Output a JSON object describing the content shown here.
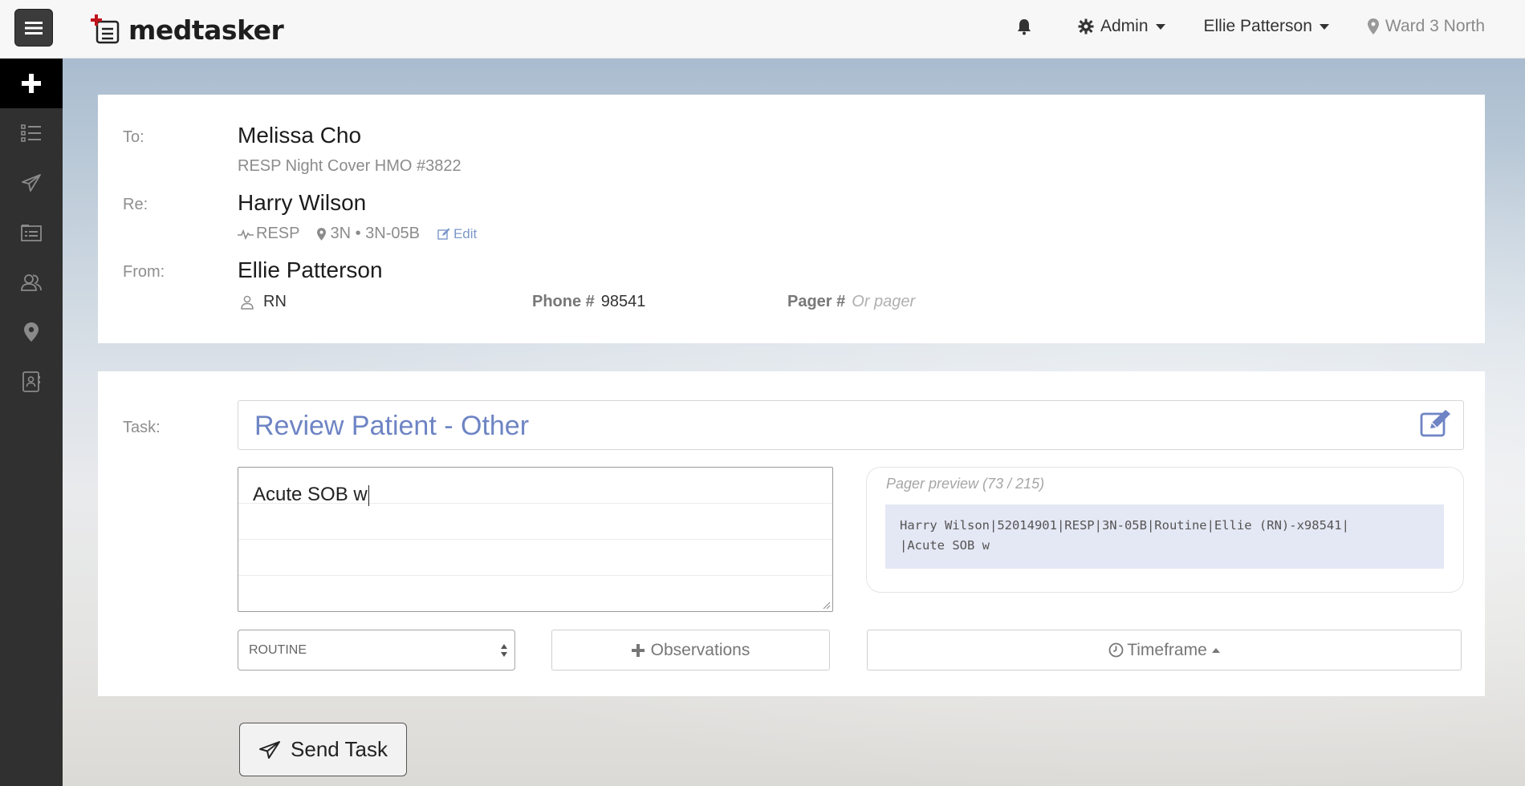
{
  "app": {
    "logo_text": "medtasker",
    "brand_color": "#c0141c"
  },
  "topnav": {
    "admin_label": "Admin",
    "user_label": "Ellie Patterson",
    "ward_label": "Ward 3 North"
  },
  "sidebar": {
    "items": [
      {
        "icon": "plus-icon",
        "active": true
      },
      {
        "icon": "task-list-icon"
      },
      {
        "icon": "send-icon"
      },
      {
        "icon": "patient-list-icon"
      },
      {
        "icon": "people-icon"
      },
      {
        "icon": "location-icon"
      },
      {
        "icon": "contacts-icon"
      }
    ]
  },
  "recipient": {
    "to_label": "To:",
    "to_name": "Melissa Cho",
    "to_role": "RESP Night Cover HMO  #3822",
    "re_label": "Re:",
    "patient_name": "Harry Wilson",
    "patient_unit": "RESP",
    "patient_location": "3N • 3N-05B",
    "edit_label": "Edit",
    "from_label": "From:",
    "from_name": "Ellie Patterson",
    "from_role": "RN",
    "phone_label": "Phone #",
    "phone_value": "98541",
    "pager_label": "Pager #",
    "pager_placeholder": "Or pager"
  },
  "task": {
    "label": "Task:",
    "title": "Review Patient - Other",
    "note_value": "Acute SOB w",
    "pager_preview_caption": "Pager preview (73 / 215)",
    "pager_preview_text": "Harry Wilson|52014901|RESP|3N-05B|Routine|Ellie (RN)-x98541|\n|Acute SOB w",
    "priority_value": "ROUTINE",
    "observations_label": "Observations",
    "timeframe_label": "Timeframe"
  },
  "actions": {
    "send_label": "Send Task"
  }
}
